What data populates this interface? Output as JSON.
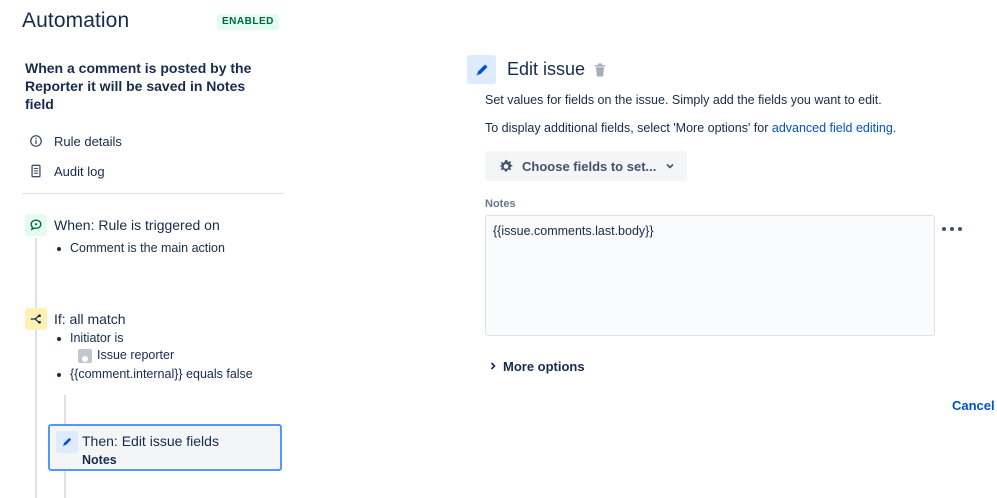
{
  "header": {
    "title": "Automation",
    "status_badge": "ENABLED"
  },
  "rule": {
    "name": "When a comment is posted by the Reporter it will be saved in Notes field"
  },
  "nav": {
    "rule_details": "Rule details",
    "audit_log": "Audit log"
  },
  "trigger": {
    "title": "When: Rule is triggered on",
    "bullets": [
      "Comment is the main action"
    ],
    "icon": "comment-icon",
    "color": "#E3FCEF"
  },
  "condition": {
    "title": "If: all match",
    "bullet1": "Initiator is",
    "bullet1_value": "Issue reporter",
    "bullet2": "{{comment.internal}} equals false",
    "icon": "branch-icon",
    "color": "#FFF0B3"
  },
  "action": {
    "title": "Then: Edit issue fields",
    "subtitle": "Notes",
    "icon": "pencil-icon"
  },
  "editor": {
    "title": "Edit issue",
    "description": "Set values for fields on the issue. Simply add the fields you want to edit.",
    "additional_prefix": "To display additional fields, select 'More options' for ",
    "additional_link": "advanced field editing.",
    "choose_button": "Choose fields to set...",
    "field_label": "Notes",
    "field_value": "{{issue.comments.last.body}}",
    "more_options": "More options",
    "cancel": "Cancel"
  },
  "colors": {
    "accent": "#0052CC",
    "selected_border": "#4C9AFF",
    "badge_bg": "#E3FCEF",
    "badge_text": "#006644"
  }
}
